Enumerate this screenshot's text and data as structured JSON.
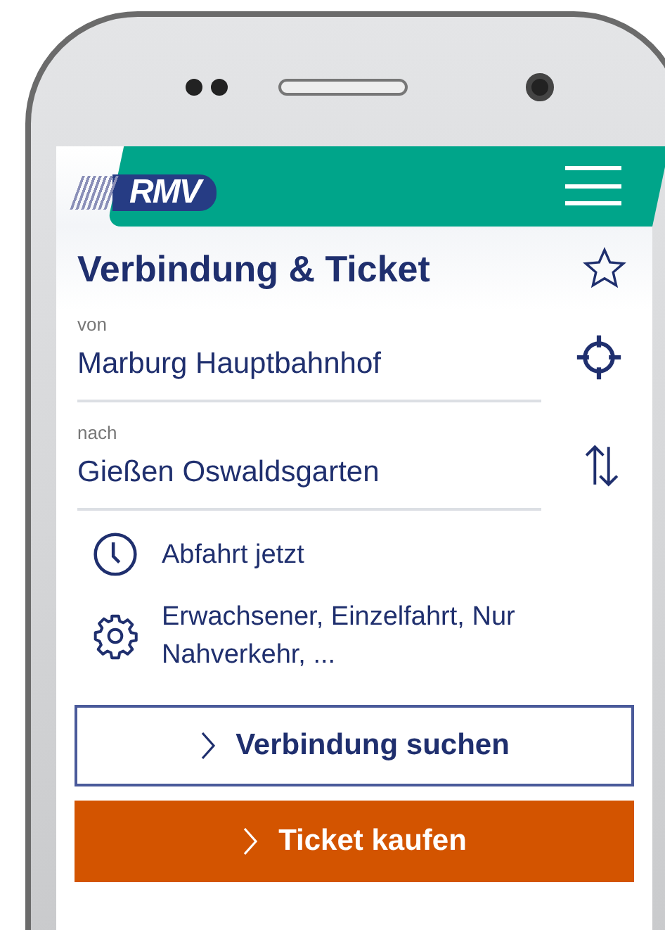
{
  "header": {
    "logo": "RMV"
  },
  "title": "Verbindung & Ticket",
  "fields": [
    {
      "label": "von",
      "value": "Marburg Hauptbahnhof",
      "kind": "locate"
    },
    {
      "label": "nach",
      "value": "Gießen Oswaldsgarten",
      "kind": "swap"
    }
  ],
  "options": [
    {
      "kind": "time",
      "text": "Abfahrt jetzt"
    },
    {
      "kind": "settings",
      "text": "Erwachsener, Einzelfahrt, Nur Nahverkehr, ..."
    }
  ],
  "buttons": [
    {
      "kind": "secondary",
      "label": "Verbindung suchen"
    },
    {
      "kind": "primary",
      "label": "Ticket kaufen"
    }
  ]
}
